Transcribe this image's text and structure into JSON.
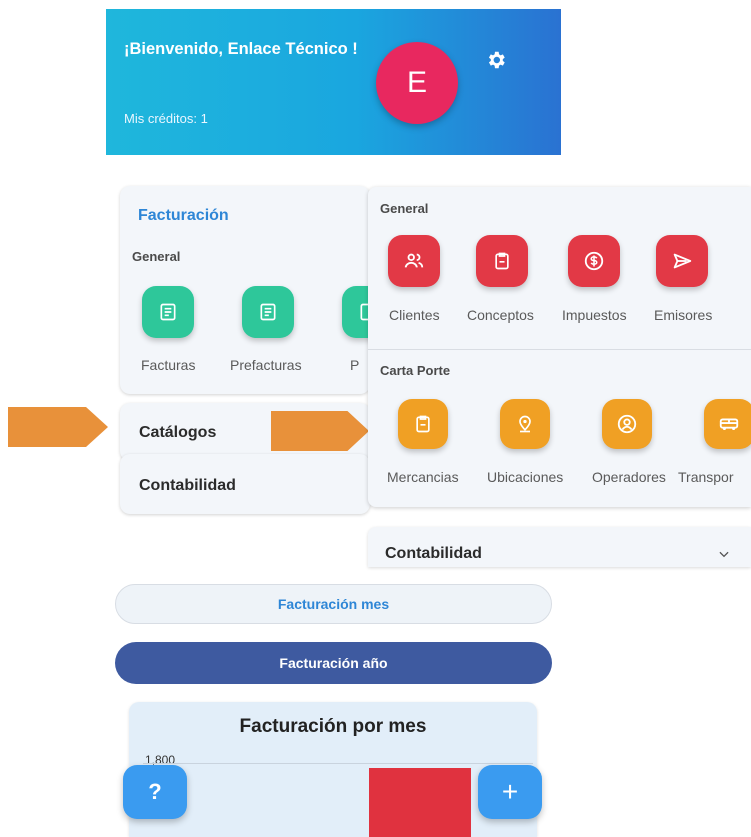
{
  "header": {
    "welcome": "¡Bienvenido, Enlace Técnico !",
    "credits": "Mis créditos: 1",
    "avatar_letter": "E"
  },
  "facturacion_card": {
    "title": "Facturación",
    "section": "General",
    "items": [
      {
        "label": "Facturas",
        "icon": "document-icon"
      },
      {
        "label": "Prefacturas",
        "icon": "document-icon"
      },
      {
        "label": "P",
        "icon": "document-icon"
      }
    ]
  },
  "catalogos": {
    "title": "Catálogos"
  },
  "contabilidad": {
    "title": "Contabilidad"
  },
  "panel": {
    "general_label": "General",
    "general_items": [
      {
        "label": "Clientes",
        "icon": "users-icon"
      },
      {
        "label": "Conceptos",
        "icon": "clipboard-icon"
      },
      {
        "label": "Impuestos",
        "icon": "dollar-icon"
      },
      {
        "label": "Emisores",
        "icon": "send-icon"
      }
    ],
    "carta_label": "Carta Porte",
    "carta_items": [
      {
        "label": "Mercancias",
        "icon": "clipboard-icon"
      },
      {
        "label": "Ubicaciones",
        "icon": "location-pin-icon"
      },
      {
        "label": "Operadores",
        "icon": "person-circle-icon"
      },
      {
        "label": "Transpor",
        "icon": "truck-icon"
      }
    ],
    "contabilidad": "Contabilidad"
  },
  "buttons": {
    "mes": "Facturación mes",
    "anio": "Facturación año"
  },
  "chart_data": {
    "type": "bar",
    "title": "Facturación por mes",
    "ytick_top": "1,800",
    "bar_color": "#e0323f"
  },
  "fab": {
    "help": "?",
    "add": "+"
  },
  "colors": {
    "green": "#2ec79a",
    "red": "#e23946",
    "orange": "#f0a024",
    "blue_button": "#3e5aa0",
    "accent": "#2e86d6"
  }
}
